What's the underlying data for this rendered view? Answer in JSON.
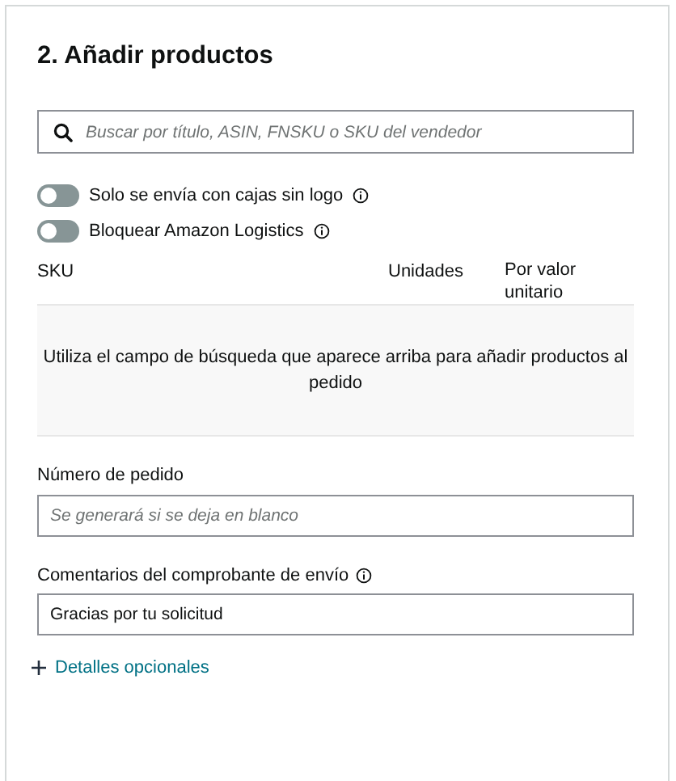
{
  "title": "2. Añadir productos",
  "search": {
    "placeholder": "Buscar por título, ASIN, FNSKU o SKU del vendedor"
  },
  "toggles": [
    {
      "label": "Solo se envía con cajas sin logo",
      "on": false,
      "info": true
    },
    {
      "label": "Bloquear Amazon Logistics",
      "on": false,
      "info": true
    }
  ],
  "table": {
    "columns": [
      "SKU",
      "Unidades",
      "Por valor unitario"
    ],
    "empty_message": "Utiliza el campo de búsqueda que aparece arriba para añadir productos al pedido"
  },
  "fields": [
    {
      "label": "Número de pedido",
      "placeholder": "Se generará si se deja en blanco",
      "info": false
    },
    {
      "label": "Comentarios del comprobante de envío",
      "value": "Gracias por tu solicitud",
      "info": true
    }
  ],
  "optional_link": "Detalles opcionales"
}
